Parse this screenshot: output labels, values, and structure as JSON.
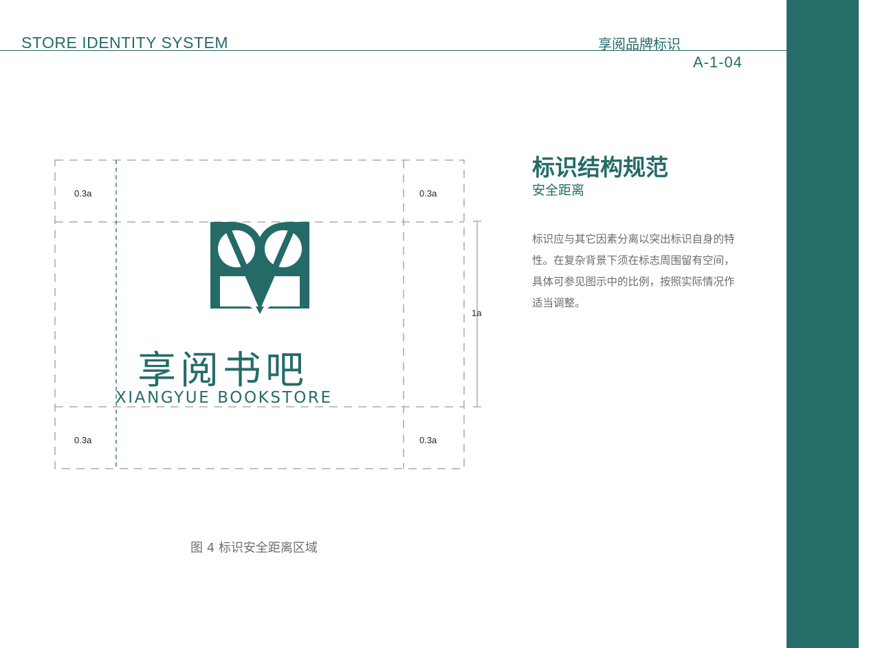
{
  "header": {
    "title": "STORE IDENTITY SYSTEM",
    "brand": "享阅品牌标识",
    "page_code": "A-1-04"
  },
  "section": {
    "title": "标识结构规范",
    "subtitle": "安全距离",
    "body": "标识应与其它因素分离以突出标识自身的特性。在复杂背景下须在标志周围留有空间，具体可参见图示中的比例，按照实际情况作适当调整。"
  },
  "diagram": {
    "labels": {
      "top_left": "0.3a",
      "top_right": "0.3a",
      "bottom_left": "0.3a",
      "bottom_right": "0.3a",
      "height": "1a"
    },
    "logo": {
      "chinese": "享阅书吧",
      "english": "XIANGYUE BOOKSTORE"
    },
    "caption": "图 4 标识安全距离区域"
  },
  "colors": {
    "brand": "#246b68",
    "sidebar": "#266d69",
    "guide": "#9a9a9a"
  }
}
